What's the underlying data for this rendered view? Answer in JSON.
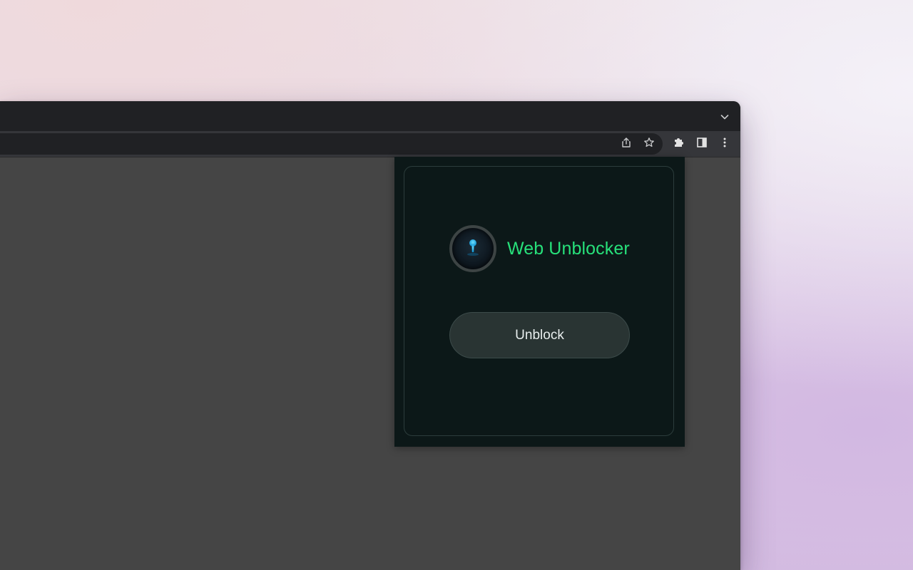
{
  "icons": {
    "tab_search": "chevron-down-icon",
    "share": "share-icon",
    "bookmark": "star-icon",
    "extensions": "puzzle-icon",
    "side_panel": "side-panel-icon",
    "menu": "kebab-menu-icon",
    "logo": "keyhole-icon"
  },
  "colors": {
    "accent_green": "#27e07a",
    "popup_background": "#0c1818",
    "button_background": "#293433",
    "keyhole_blue": "#19b4f0"
  },
  "popup": {
    "title": "Web Unblocker",
    "button_label": "Unblock"
  }
}
